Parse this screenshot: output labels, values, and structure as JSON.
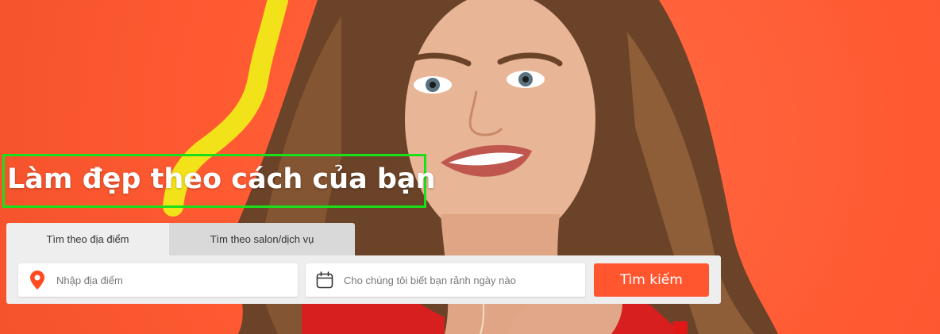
{
  "hero": {
    "headline": "Làm đẹp theo cách của bạn",
    "background_color": "#ff5f3a",
    "highlight_color": "#19e01a",
    "stripe_color": "#f2e21a"
  },
  "search": {
    "tabs": [
      {
        "label": "Tìm theo địa điểm",
        "active": true
      },
      {
        "label": "Tìm theo salon/dịch vụ",
        "active": false
      }
    ],
    "location_placeholder": "Nhập địa điểm",
    "date_placeholder": "Cho chúng tôi biết bạn rảnh ngày nào",
    "button_label": "Tìm kiếm",
    "button_color": "#ff5630",
    "location_icon": "map-pin-icon",
    "date_icon": "calendar-icon"
  }
}
